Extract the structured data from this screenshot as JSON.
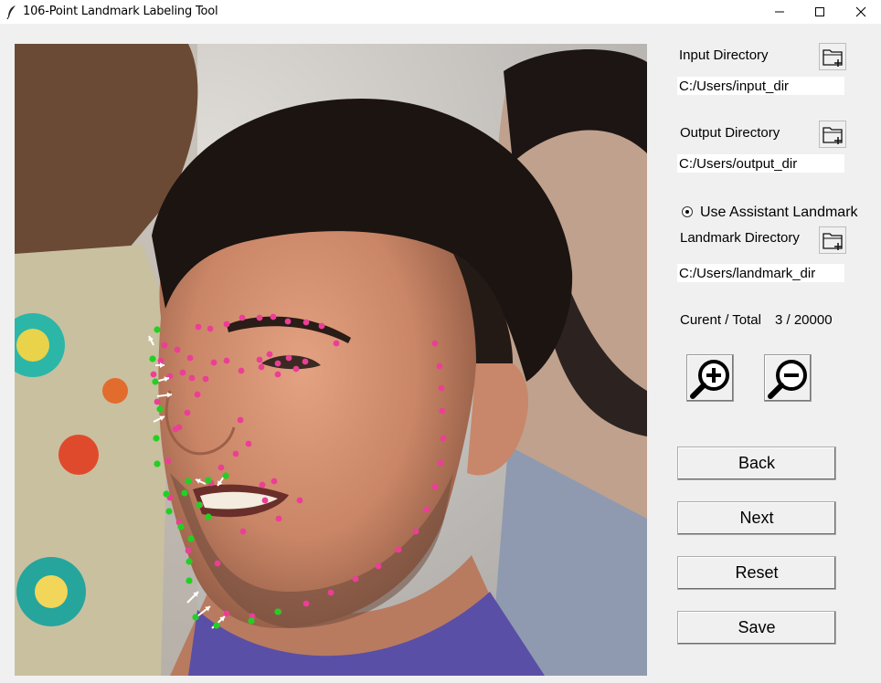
{
  "window": {
    "title": "106-Point Landmark Labeling Tool",
    "icon": "feather-icon",
    "controls": [
      "minimize-icon",
      "maximize-icon",
      "close-icon"
    ]
  },
  "canvas": {
    "description_icon": "face-image",
    "landmark_colors": {
      "point": "#ec3e96",
      "assist": "#22d022",
      "arrow": "#ffffff"
    }
  },
  "sidebar": {
    "input_dir": {
      "label": "Input Directory",
      "value": "C:/Users/input_dir",
      "icon": "folder-add-icon"
    },
    "output_dir": {
      "label": "Output Directory",
      "value": "C:/Users/output_dir",
      "icon": "folder-add-icon"
    },
    "assistant": {
      "label": "Use Assistant Landmark",
      "checked": true
    },
    "landmark_dir": {
      "label": "Landmark Directory",
      "value": "C:/Users/landmark_dir",
      "icon": "folder-add-icon"
    },
    "progress": {
      "label": "Curent / Total",
      "value": "3 / 20000"
    },
    "zoom": {
      "in_icon": "zoom-in-icon",
      "out_icon": "zoom-out-icon"
    },
    "buttons": {
      "back": "Back",
      "next": "Next",
      "reset": "Reset",
      "save": "Save"
    }
  }
}
